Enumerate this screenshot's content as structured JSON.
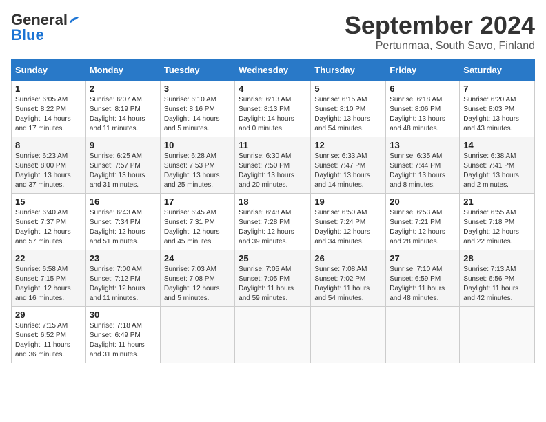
{
  "header": {
    "logo_general": "General",
    "logo_blue": "Blue",
    "month_title": "September 2024",
    "location": "Pertunmaa, South Savo, Finland"
  },
  "weekdays": [
    "Sunday",
    "Monday",
    "Tuesday",
    "Wednesday",
    "Thursday",
    "Friday",
    "Saturday"
  ],
  "weeks": [
    [
      {
        "day": "1",
        "info": "Sunrise: 6:05 AM\nSunset: 8:22 PM\nDaylight: 14 hours\nand 17 minutes."
      },
      {
        "day": "2",
        "info": "Sunrise: 6:07 AM\nSunset: 8:19 PM\nDaylight: 14 hours\nand 11 minutes."
      },
      {
        "day": "3",
        "info": "Sunrise: 6:10 AM\nSunset: 8:16 PM\nDaylight: 14 hours\nand 5 minutes."
      },
      {
        "day": "4",
        "info": "Sunrise: 6:13 AM\nSunset: 8:13 PM\nDaylight: 14 hours\nand 0 minutes."
      },
      {
        "day": "5",
        "info": "Sunrise: 6:15 AM\nSunset: 8:10 PM\nDaylight: 13 hours\nand 54 minutes."
      },
      {
        "day": "6",
        "info": "Sunrise: 6:18 AM\nSunset: 8:06 PM\nDaylight: 13 hours\nand 48 minutes."
      },
      {
        "day": "7",
        "info": "Sunrise: 6:20 AM\nSunset: 8:03 PM\nDaylight: 13 hours\nand 43 minutes."
      }
    ],
    [
      {
        "day": "8",
        "info": "Sunrise: 6:23 AM\nSunset: 8:00 PM\nDaylight: 13 hours\nand 37 minutes."
      },
      {
        "day": "9",
        "info": "Sunrise: 6:25 AM\nSunset: 7:57 PM\nDaylight: 13 hours\nand 31 minutes."
      },
      {
        "day": "10",
        "info": "Sunrise: 6:28 AM\nSunset: 7:53 PM\nDaylight: 13 hours\nand 25 minutes."
      },
      {
        "day": "11",
        "info": "Sunrise: 6:30 AM\nSunset: 7:50 PM\nDaylight: 13 hours\nand 20 minutes."
      },
      {
        "day": "12",
        "info": "Sunrise: 6:33 AM\nSunset: 7:47 PM\nDaylight: 13 hours\nand 14 minutes."
      },
      {
        "day": "13",
        "info": "Sunrise: 6:35 AM\nSunset: 7:44 PM\nDaylight: 13 hours\nand 8 minutes."
      },
      {
        "day": "14",
        "info": "Sunrise: 6:38 AM\nSunset: 7:41 PM\nDaylight: 13 hours\nand 2 minutes."
      }
    ],
    [
      {
        "day": "15",
        "info": "Sunrise: 6:40 AM\nSunset: 7:37 PM\nDaylight: 12 hours\nand 57 minutes."
      },
      {
        "day": "16",
        "info": "Sunrise: 6:43 AM\nSunset: 7:34 PM\nDaylight: 12 hours\nand 51 minutes."
      },
      {
        "day": "17",
        "info": "Sunrise: 6:45 AM\nSunset: 7:31 PM\nDaylight: 12 hours\nand 45 minutes."
      },
      {
        "day": "18",
        "info": "Sunrise: 6:48 AM\nSunset: 7:28 PM\nDaylight: 12 hours\nand 39 minutes."
      },
      {
        "day": "19",
        "info": "Sunrise: 6:50 AM\nSunset: 7:24 PM\nDaylight: 12 hours\nand 34 minutes."
      },
      {
        "day": "20",
        "info": "Sunrise: 6:53 AM\nSunset: 7:21 PM\nDaylight: 12 hours\nand 28 minutes."
      },
      {
        "day": "21",
        "info": "Sunrise: 6:55 AM\nSunset: 7:18 PM\nDaylight: 12 hours\nand 22 minutes."
      }
    ],
    [
      {
        "day": "22",
        "info": "Sunrise: 6:58 AM\nSunset: 7:15 PM\nDaylight: 12 hours\nand 16 minutes."
      },
      {
        "day": "23",
        "info": "Sunrise: 7:00 AM\nSunset: 7:12 PM\nDaylight: 12 hours\nand 11 minutes."
      },
      {
        "day": "24",
        "info": "Sunrise: 7:03 AM\nSunset: 7:08 PM\nDaylight: 12 hours\nand 5 minutes."
      },
      {
        "day": "25",
        "info": "Sunrise: 7:05 AM\nSunset: 7:05 PM\nDaylight: 11 hours\nand 59 minutes."
      },
      {
        "day": "26",
        "info": "Sunrise: 7:08 AM\nSunset: 7:02 PM\nDaylight: 11 hours\nand 54 minutes."
      },
      {
        "day": "27",
        "info": "Sunrise: 7:10 AM\nSunset: 6:59 PM\nDaylight: 11 hours\nand 48 minutes."
      },
      {
        "day": "28",
        "info": "Sunrise: 7:13 AM\nSunset: 6:56 PM\nDaylight: 11 hours\nand 42 minutes."
      }
    ],
    [
      {
        "day": "29",
        "info": "Sunrise: 7:15 AM\nSunset: 6:52 PM\nDaylight: 11 hours\nand 36 minutes."
      },
      {
        "day": "30",
        "info": "Sunrise: 7:18 AM\nSunset: 6:49 PM\nDaylight: 11 hours\nand 31 minutes."
      },
      {
        "day": "",
        "info": ""
      },
      {
        "day": "",
        "info": ""
      },
      {
        "day": "",
        "info": ""
      },
      {
        "day": "",
        "info": ""
      },
      {
        "day": "",
        "info": ""
      }
    ]
  ]
}
